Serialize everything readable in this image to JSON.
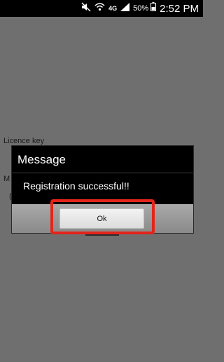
{
  "status_bar": {
    "network_type": "4G",
    "battery_percent": "50%",
    "time": "2:52 PM"
  },
  "background": {
    "licence_key_label": "Licence key",
    "mac_label": "M",
    "value_fragment": "(1"
  },
  "dialog": {
    "title": "Message",
    "message": "Registration successful!!",
    "ok_label": "Ok"
  },
  "colors": {
    "overlay_bg": "#6f6f6f",
    "dialog_bg": "#000000",
    "highlight": "#e3241b"
  }
}
